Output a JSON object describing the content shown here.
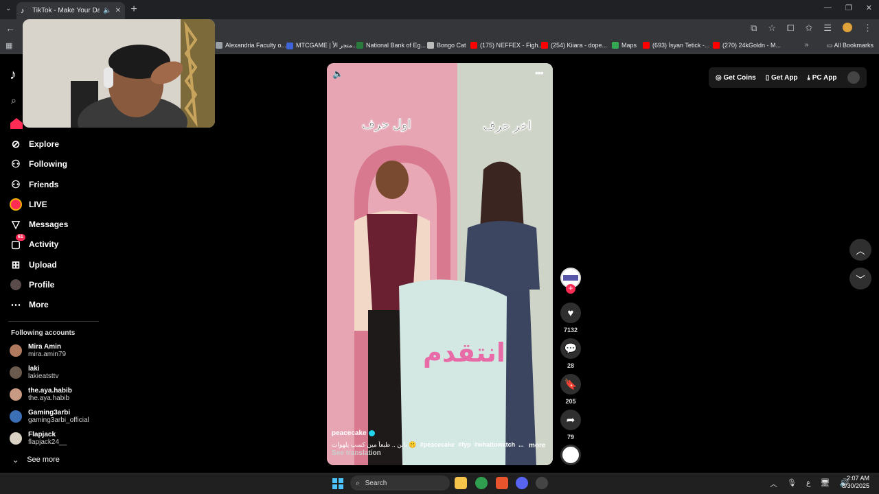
{
  "browser": {
    "tab_title": "TikTok - Make Your Day",
    "tab_favicon": "tiktok-icon",
    "bookmarks": [
      {
        "label": "Alexandria Faculty o...",
        "color": "#9aa0a6"
      },
      {
        "label": "MTCGAME | متجر الأ...",
        "color": "#3f63d9"
      },
      {
        "label": "National Bank of Eg...",
        "color": "#2b7a3d"
      },
      {
        "label": "Bongo Cat",
        "color": "#bbbbbb"
      },
      {
        "label": "(175) NEFFEX - Figh...",
        "color": "#ff0000"
      },
      {
        "label": "(254) Kiiara - dope...",
        "color": "#ff0000"
      },
      {
        "label": "Maps",
        "color": "#34a853"
      },
      {
        "label": "(693) İsyan Tetick -...",
        "color": "#ff0000"
      },
      {
        "label": "(270) 24kGoldn - M...",
        "color": "#ff0000"
      }
    ],
    "all_bookmarks": "All Bookmarks"
  },
  "sidebar": {
    "nav": [
      {
        "label": "Explore",
        "icon": "compass-icon"
      },
      {
        "label": "Following",
        "icon": "following-icon"
      },
      {
        "label": "Friends",
        "icon": "friends-icon"
      },
      {
        "label": "LIVE",
        "icon": "live-icon"
      },
      {
        "label": "Messages",
        "icon": "messages-icon"
      },
      {
        "label": "Activity",
        "icon": "activity-icon",
        "badge": "61"
      },
      {
        "label": "Upload",
        "icon": "upload-icon"
      },
      {
        "label": "Profile",
        "icon": "profile-icon"
      },
      {
        "label": "More",
        "icon": "more-icon"
      }
    ],
    "following_title": "Following accounts",
    "accounts": [
      {
        "name": "Mira Amin",
        "user": "mira.amin79",
        "color": "#b07a5e"
      },
      {
        "name": "laki",
        "user": "lakieatsttv",
        "color": "#6b5a4e"
      },
      {
        "name": "the.aya.habib",
        "user": "the.aya.habib",
        "color": "#c89a84"
      },
      {
        "name": "Gaming3arbi",
        "user": "gaming3arbi_official",
        "color": "#3b6fb6"
      },
      {
        "name": "Flapjack",
        "user": "flapjack24__",
        "color": "#d9d2c4"
      }
    ],
    "see_more": "See more"
  },
  "video": {
    "overlay_left": "اول حرف",
    "overlay_right": "اخر حرف",
    "author": "peacecake",
    "caption": "بابن .. طبعاً مين كسب يلهوات 🤫",
    "hashtags": [
      "#peacecake",
      "#fyp",
      "#whattowatch",
      "..."
    ],
    "more": "more",
    "see_translation": "See translation"
  },
  "actions": {
    "likes": "7132",
    "comments": "28",
    "saves": "205",
    "shares": "79"
  },
  "header": {
    "get_coins": "Get Coins",
    "get_app": "Get App",
    "pc_app": "PC App"
  },
  "taskbar": {
    "search": "Search",
    "time": "2:07 AM",
    "date": "8/30/2025",
    "lang": "ع"
  }
}
